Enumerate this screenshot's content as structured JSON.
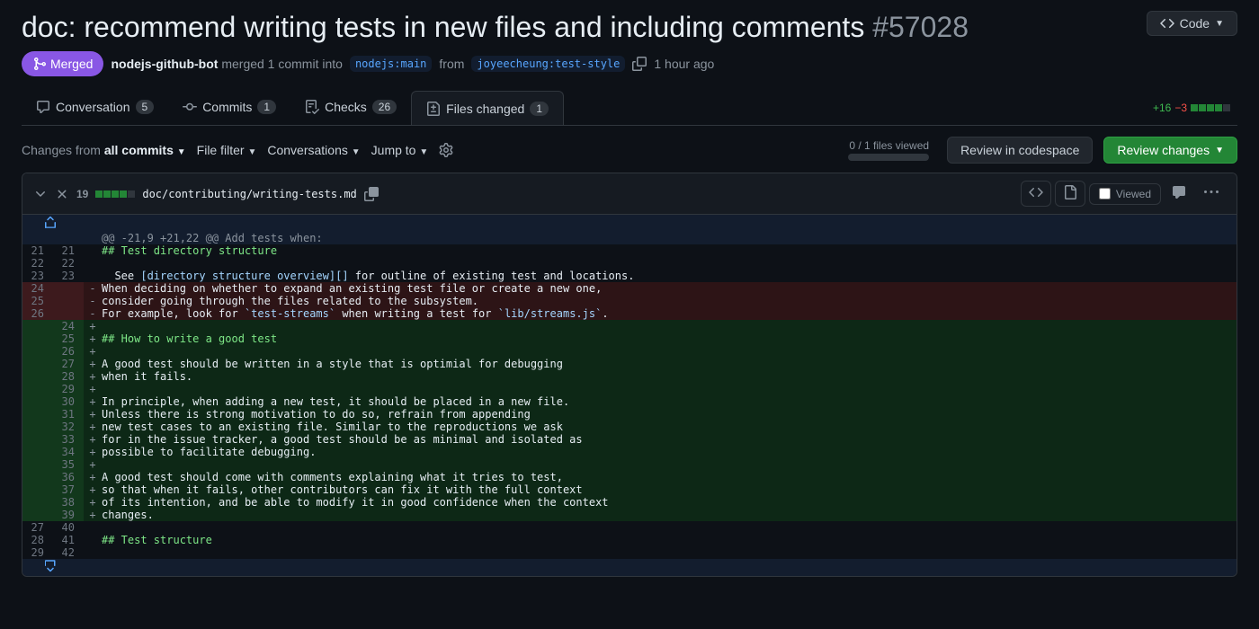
{
  "pr": {
    "title": "doc: recommend writing tests in new files and including comments",
    "number": "#57028",
    "status": "Merged",
    "author": "nodejs-github-bot",
    "merge_verb": "merged 1 commit into",
    "base_branch": "nodejs:main",
    "from_word": "from",
    "head_branch": "joyeecheung:test-style",
    "time": "1 hour ago",
    "code_btn": "Code"
  },
  "tabs": {
    "conversation": "Conversation",
    "conversation_n": "5",
    "commits": "Commits",
    "commits_n": "1",
    "checks": "Checks",
    "checks_n": "26",
    "files": "Files changed",
    "files_n": "1"
  },
  "diffstat": {
    "added": "+16",
    "removed": "−3"
  },
  "toolbar": {
    "changes_from": "Changes from",
    "all_commits": "all commits",
    "file_filter": "File filter",
    "conversations": "Conversations",
    "jump_to": "Jump to",
    "progress": "0 / 1 files viewed",
    "review_codespace": "Review in codespace",
    "review_changes": "Review changes"
  },
  "file": {
    "stat": "19",
    "path": "doc/contributing/writing-tests.md",
    "viewed": "Viewed"
  },
  "hunk": "@@ -21,9 +21,22 @@ Add tests when:",
  "lines": {
    "l21": "## Test directory structure",
    "l22": "",
    "l23_a": "  See ",
    "l23_b": "[directory structure overview][]",
    "l23_c": " for outline of existing test and locations.",
    "d24": "When deciding on whether to expand an existing test file or create a new one,",
    "d25": "consider going through the files related to the subsystem.",
    "d26_a": "For example, look for ",
    "d26_b": "`test-streams`",
    "d26_c": " when writing a test for ",
    "d26_d": "`lib/streams.js`",
    "d26_e": ".",
    "a24": "",
    "a25": "## How to write a good test",
    "a26": "",
    "a27": "A good test should be written in a style that is optimial for debugging",
    "a28": "when it fails.",
    "a29": "",
    "a30": "In principle, when adding a new test, it should be placed in a new file.",
    "a31": "Unless there is strong motivation to do so, refrain from appending",
    "a32": "new test cases to an existing file. Similar to the reproductions we ask",
    "a33": "for in the issue tracker, a good test should be as minimal and isolated as",
    "a34": "possible to facilitate debugging.",
    "a35": "",
    "a36": "A good test should come with comments explaining what it tries to test,",
    "a37": "so that when it fails, other contributors can fix it with the full context",
    "a38": "of its intention, and be able to modify it in good confidence when the context",
    "a39": "changes.",
    "l40": "",
    "l41": "## Test structure",
    "l42": ""
  }
}
